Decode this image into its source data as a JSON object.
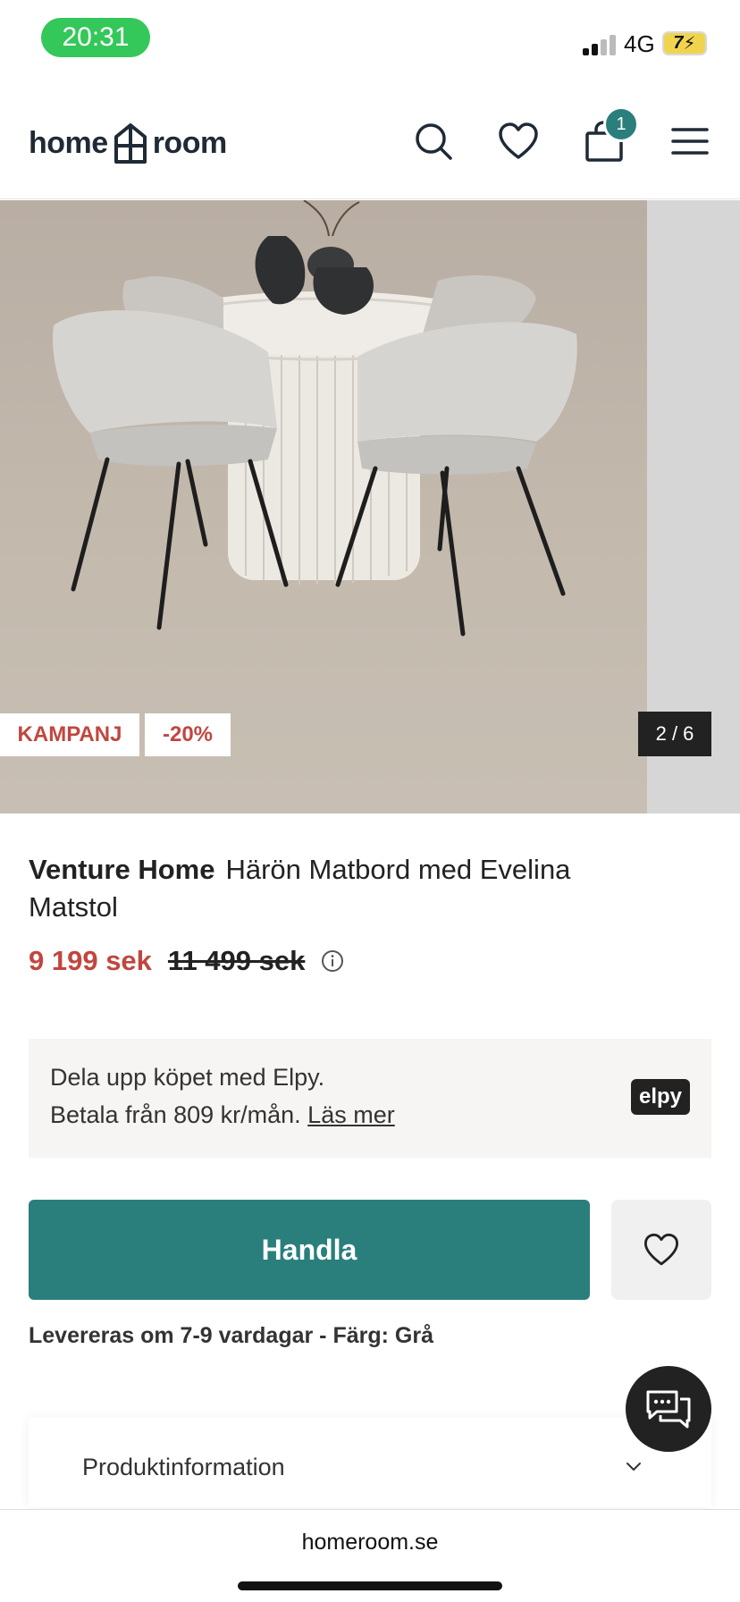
{
  "status_bar": {
    "time": "20:31",
    "network": "4G",
    "battery": "7"
  },
  "header": {
    "logo_left": "home",
    "logo_right": "room",
    "cart_count": "1"
  },
  "gallery": {
    "tag_campaign": "KAMPANJ",
    "tag_discount": "-20%",
    "counter": "2 / 6"
  },
  "product": {
    "brand": "Venture Home",
    "name": "Härön Matbord med Evelina Matstol",
    "price_now": "9 199 sek",
    "price_old": "11 499 sek"
  },
  "elpy": {
    "line1": "Dela upp köpet med Elpy.",
    "line2": "Betala från 809 kr/mån.",
    "link": "Läs mer",
    "logo_text": "elpy"
  },
  "actions": {
    "buy_label": "Handla",
    "delivery": "Levereras om 7-9 vardagar - Färg: Grå"
  },
  "accordion": {
    "label": "Produktinformation"
  },
  "browser": {
    "url": "homeroom.se"
  },
  "colors": {
    "accent": "#2a7f7c",
    "sale": "#c0473e",
    "status_green": "#34c759"
  }
}
